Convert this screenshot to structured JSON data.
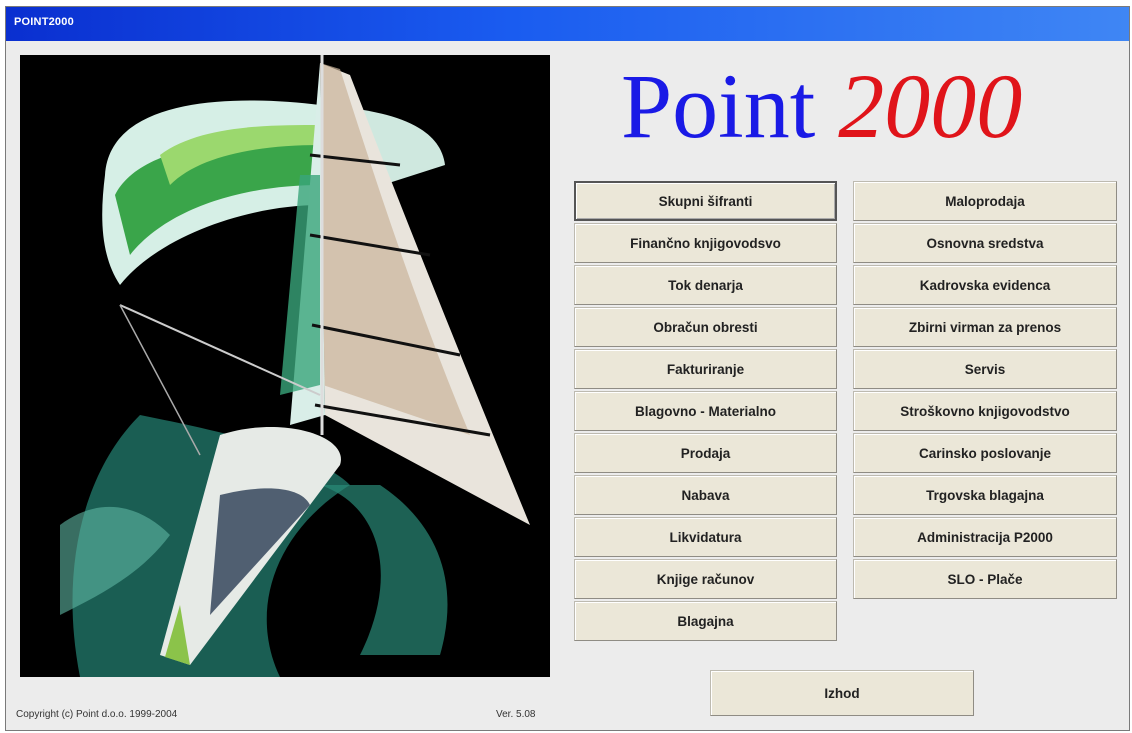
{
  "window": {
    "title": "POINT2000"
  },
  "brand": {
    "word": "Point",
    "number": "2000"
  },
  "menu_left": [
    "Skupni šifranti",
    "Finančno knjigovodsvo",
    "Tok denarja",
    "Obračun obresti",
    "Fakturiranje",
    "Blagovno - Materialno",
    "Prodaja",
    "Nabava",
    "Likvidatura",
    "Knjige računov",
    "Blagajna"
  ],
  "menu_right": [
    "Maloprodaja",
    "Osnovna sredstva",
    "Kadrovska evidenca",
    "Zbirni virman za prenos",
    "Servis",
    "Stroškovno knjigovodstvo",
    "Carinsko poslovanje",
    "Trgovska blagajna",
    "Administracija P2000",
    "SLO - Plače"
  ],
  "exit_label": "Izhod",
  "footer": {
    "copyright": "Copyright (c) Point d.o.o. 1999-2004",
    "version": "Ver. 5.08"
  }
}
